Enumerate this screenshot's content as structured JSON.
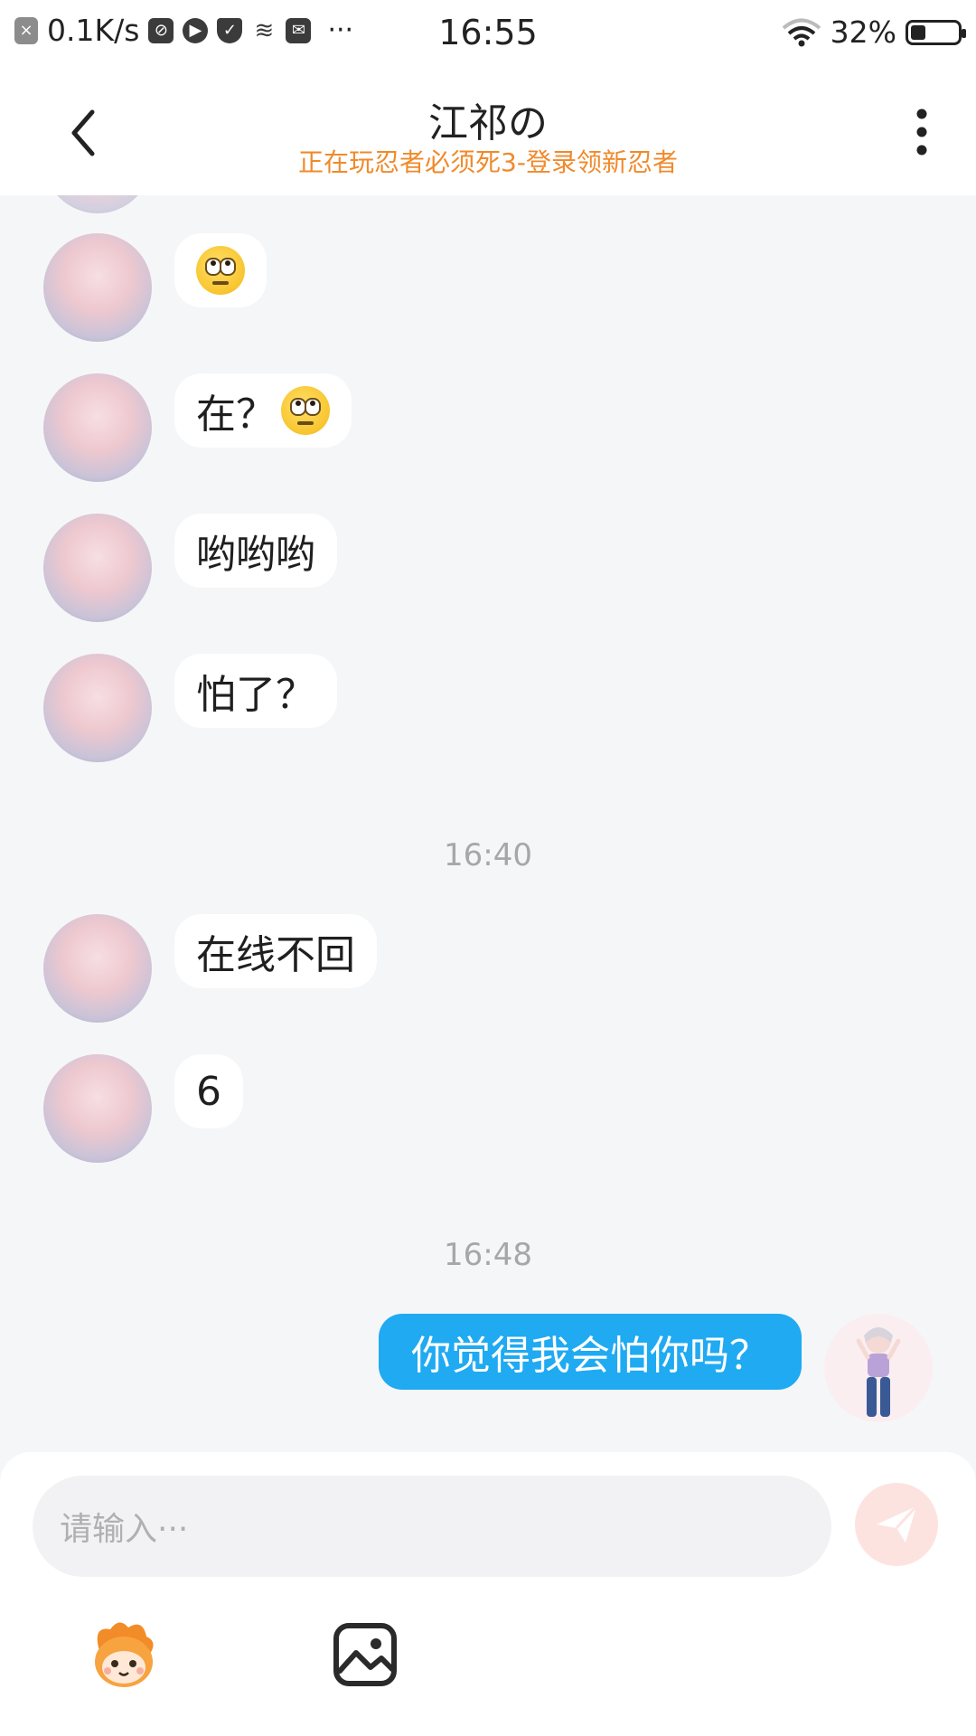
{
  "status_bar": {
    "network_speed": "0.1K/s",
    "time": "16:55",
    "battery": "32%",
    "battery_level": 0.32,
    "more": "···"
  },
  "header": {
    "title": "江祁の",
    "subtitle": "正在玩忍者必须死3-登录领新忍者"
  },
  "messages": [
    {
      "text": "",
      "emoji": "face-with-rolling-eyes"
    },
    {
      "text": "在？",
      "emoji": "face-with-rolling-eyes"
    },
    {
      "text": "哟哟哟"
    },
    {
      "text": "怕了？"
    },
    {
      "text": "在线不回"
    },
    {
      "text": "6"
    }
  ],
  "timestamps": [
    "16:40",
    "16:48"
  ],
  "my_messages": [
    {
      "text": "你觉得我会怕你吗？"
    }
  ],
  "input": {
    "placeholder": "请输入···"
  },
  "colors": {
    "subtitle": "#f08a2b",
    "my_bubble": "#1faaf2",
    "send_button": "#fde3e0"
  },
  "icons": [
    "back-arrow",
    "more-vertical",
    "send",
    "mascot-sticker",
    "image-picker"
  ]
}
